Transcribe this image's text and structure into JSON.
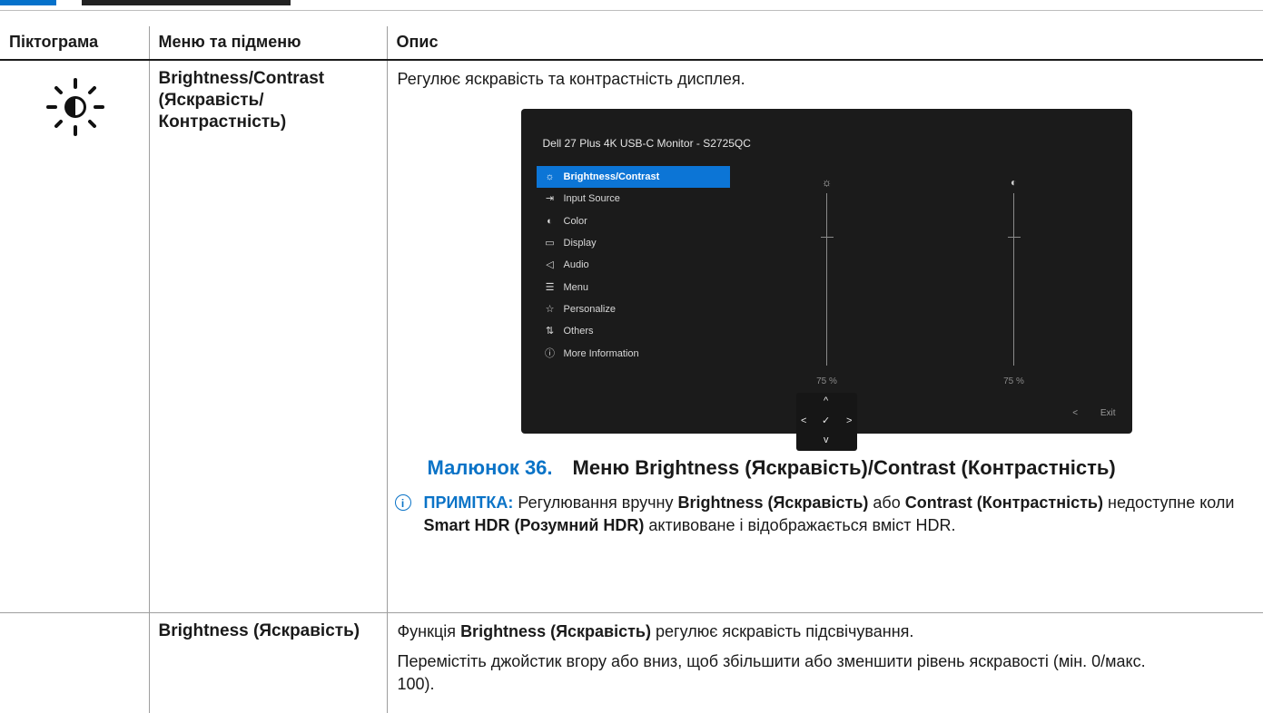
{
  "header": {
    "col_icon": "Піктограма",
    "col_menu": "Меню та підменю",
    "col_desc": "Опис"
  },
  "row1": {
    "menu_name": "Brightness/Contrast (Яскравість/ Контрастність)",
    "desc": "Регулює яскравість та контрастність дисплея.",
    "osd": {
      "title": "Dell 27 Plus 4K USB-C Monitor - S2725QC",
      "menu_items": [
        {
          "icon": "☼",
          "label": "Brightness/Contrast"
        },
        {
          "icon": "⇥",
          "label": "Input Source"
        },
        {
          "icon": "◐",
          "label": "Color"
        },
        {
          "icon": "▭",
          "label": "Display"
        },
        {
          "icon": "◁",
          "label": "Audio"
        },
        {
          "icon": "☰",
          "label": "Menu"
        },
        {
          "icon": "☆",
          "label": "Personalize"
        },
        {
          "icon": "⇅",
          "label": "Others"
        },
        {
          "icon": "ⓘ",
          "label": "More Information"
        }
      ],
      "brightness_value": "75 %",
      "contrast_value": "75 %",
      "brightness_level": 0.75,
      "contrast_level": 0.75,
      "back_symbol": "<",
      "exit_label": "Exit"
    },
    "joystick": {
      "up": "^",
      "down": "v",
      "left": "<",
      "right": ">",
      "center": "✓"
    },
    "caption_number": "Малюнок 36.",
    "caption_text": "Меню Brightness (Яскравість)/Contrast (Контрастність)",
    "note_label": "ПРИМІТКА:",
    "note_t1": " Регулювання вручну ",
    "note_b1": "Brightness (Яскравість)",
    "note_t2": " або ",
    "note_b2": "Contrast (Контрастність)",
    "note_t3": " недоступне коли ",
    "note_b3": "Smart HDR (Розумний HDR)",
    "note_t4": " активоване і відображається вміст HDR."
  },
  "row2": {
    "menu_name": "Brightness (Яскравість)",
    "p1_t1": "Функція ",
    "p1_b1": "Brightness (Яскравість)",
    "p1_t2": " регулює яскравість підсвічування.",
    "p2": "Перемістіть джойстик вгору або вниз, щоб збільшити або зменшити рівень яскравості (мін. 0/макс. 100)."
  }
}
